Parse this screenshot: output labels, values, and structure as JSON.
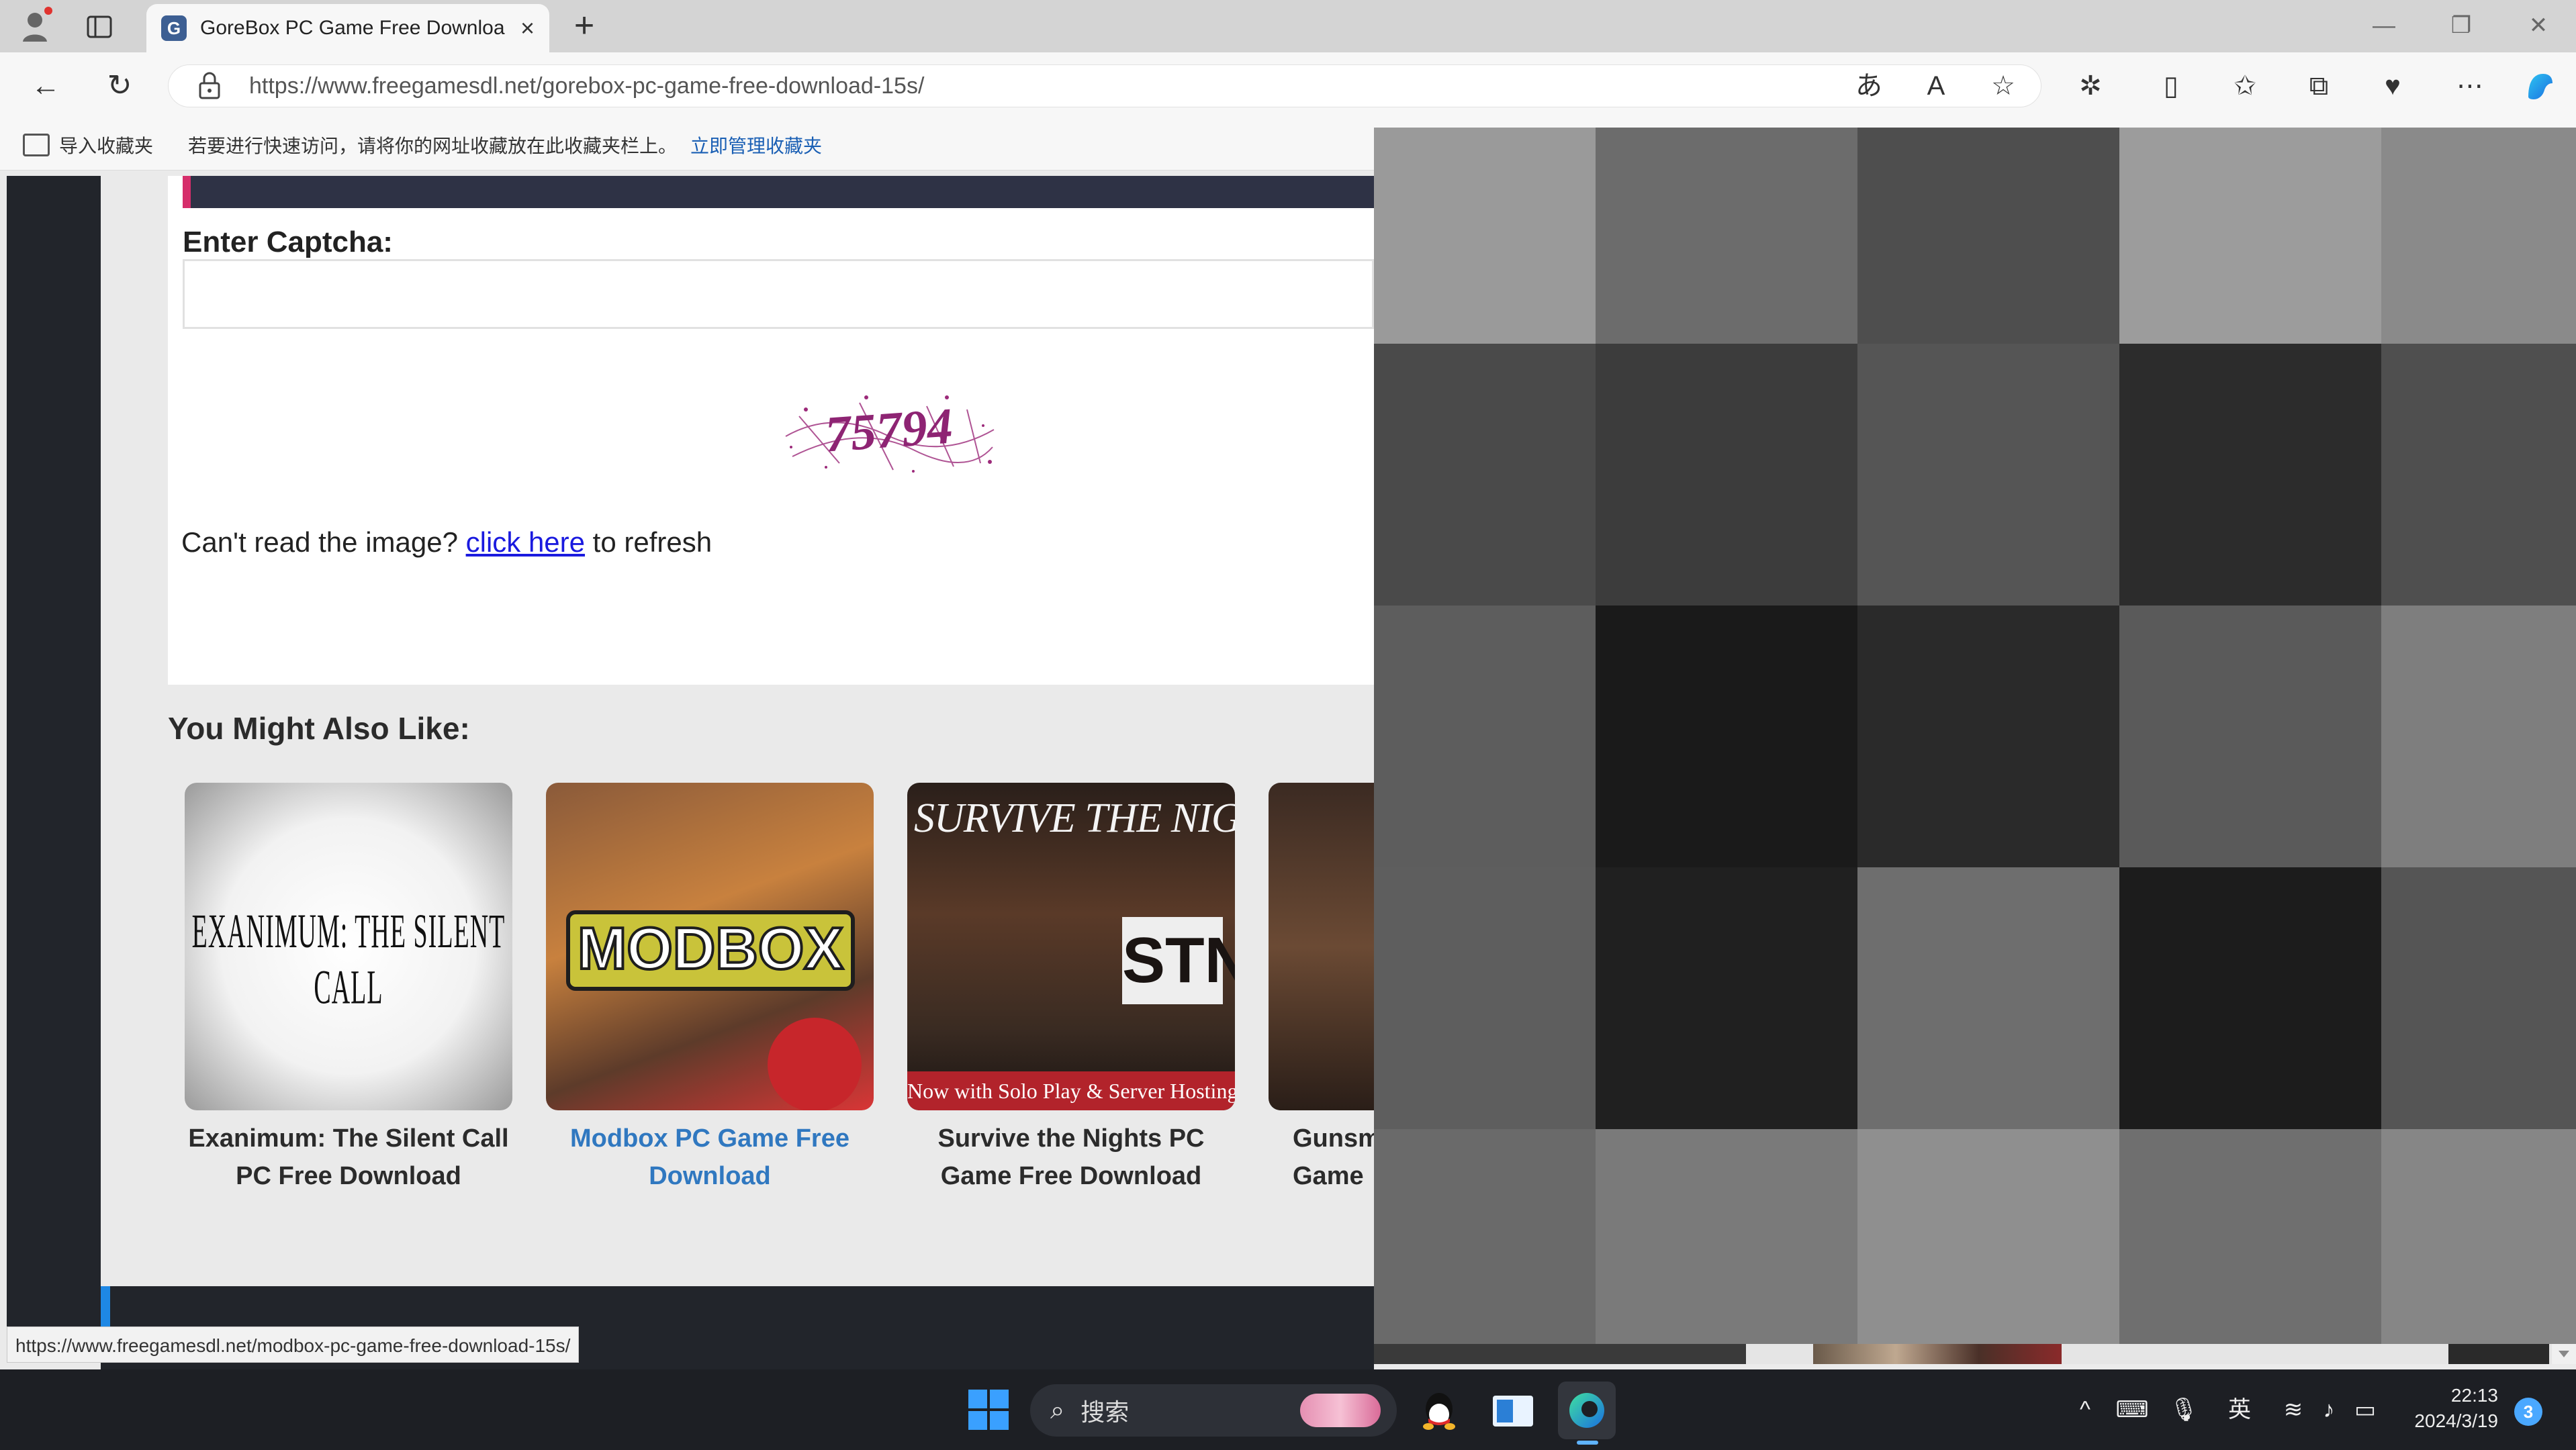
{
  "browser": {
    "tab_title": "GoreBox PC Game Free Downloa",
    "tab_close": "×",
    "new_tab": "+",
    "tab_favicon_letter": "G",
    "url": "https://www.freegamesdl.net/gorebox-pc-game-free-download-15s/",
    "window_minimize": "—",
    "window_restore": "❐",
    "window_close": "✕"
  },
  "favorites_bar": {
    "import_label": "导入收藏夹",
    "message": "若要进行快速访问，请将你的网址收藏放在此收藏夹栏上。",
    "manage_link": "立即管理收藏夹"
  },
  "page": {
    "captcha_label": "Enter Captcha:",
    "captcha_text": "75794",
    "cant_read_prefix": "Can't read the image? ",
    "click_here": "click here",
    "cant_read_suffix": " to refresh",
    "also_like_heading": "You Might Also Like:",
    "related_games": [
      {
        "title_line1": "Exanimum: The Silent Call",
        "title_line2": "PC Free Download",
        "thumb_text": "EXANIMUM: THE SILENT CALL"
      },
      {
        "title_line1": "Modbox PC Game Free",
        "title_line2": "Download",
        "thumb_text": "MODBOX"
      },
      {
        "title_line1": "Survive the Nights PC",
        "title_line2": "Game Free Download",
        "thumb_text": "SURVIVE THE NIGHTS",
        "thumb_badge": "STN",
        "thumb_caption": "Now with Solo Play & Server Hosting"
      },
      {
        "title_line1": "Gunsm",
        "title_line2": "Game"
      }
    ]
  },
  "status_bar": {
    "hover_url": "https://www.freegamesdl.net/modbox-pc-game-free-download-15s/"
  },
  "taskbar": {
    "search_placeholder": "搜索",
    "ime_label": "英",
    "time": "22:13",
    "date": "2024/3/19",
    "notification_count": "3"
  },
  "colors": {
    "accent_pink": "#d62e6b",
    "link_blue": "#1a1adf",
    "related_link": "#3078c0",
    "dark_header": "#2e3245",
    "taskbar_bg": "#1d1f24"
  },
  "pixelation_shades": [
    "#9a9a9a",
    "#6c6c6c",
    "#4e4e4e",
    "#9c9c9c",
    "#8a8a8a",
    "#4a4a4a",
    "#3c3c3c",
    "#555555",
    "#2c2c2c",
    "#4f4f4f",
    "#5d5d5d",
    "#1a1a1a",
    "#2a2a2a",
    "#5a5a5a",
    "#7e7e7e",
    "#5e5e5e",
    "#202020",
    "#6e6e6e",
    "#1c1c1c",
    "#555555",
    "#6a6a6a",
    "#7a7a7a",
    "#8f8f8f",
    "#6f6f6f",
    "#868686"
  ]
}
